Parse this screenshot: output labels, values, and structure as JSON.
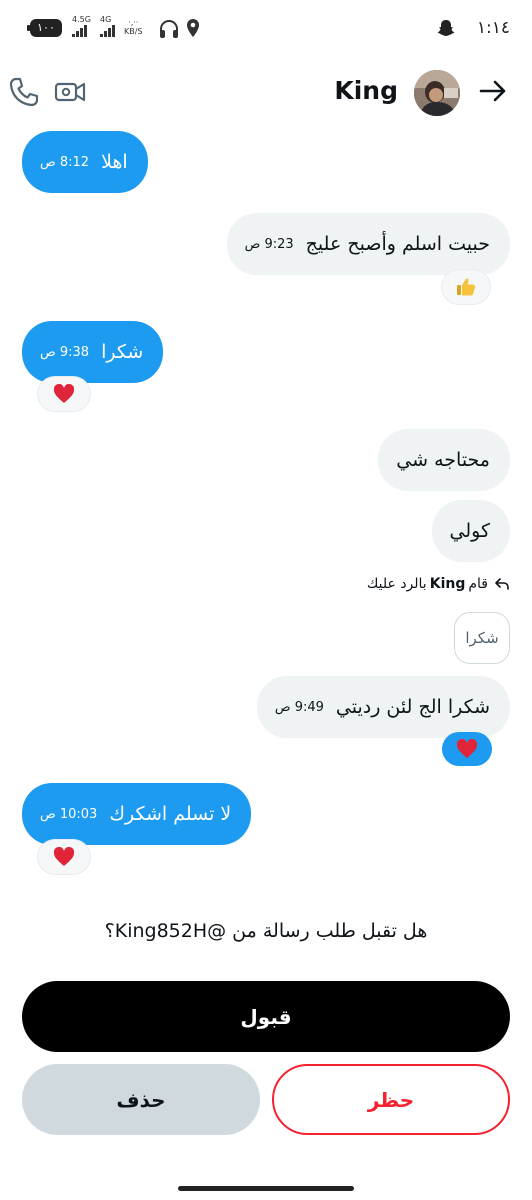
{
  "status_bar": {
    "time": "١:١٤",
    "battery": "١٠٠",
    "signal_1": "4.5G",
    "signal_2": "4G",
    "net_speed_value": "·,··",
    "net_speed_unit": "KB/S"
  },
  "header": {
    "contact_name": "King"
  },
  "messages": [
    {
      "text": "اهلا",
      "time": "8:12 ص",
      "direction": "incoming"
    },
    {
      "text": "حبيت اسلم وأصبح عليج",
      "time": "9:23 ص",
      "direction": "outgoing",
      "reaction": "thumbs-up"
    },
    {
      "text": "شكرا",
      "time": "9:38 ص",
      "direction": "incoming",
      "reaction": "heart"
    },
    {
      "text": "محتاجه شي",
      "time": "",
      "direction": "outgoing"
    },
    {
      "text": "كولي",
      "time": "",
      "direction": "outgoing"
    },
    {
      "text": "شكرا الج لئن رديتي",
      "time": "9:49 ص",
      "direction": "outgoing",
      "reaction": "heart"
    },
    {
      "text": "لا تسلم اشكرك",
      "time": "10:03 ص",
      "direction": "incoming",
      "reaction": "heart"
    }
  ],
  "reply_note": {
    "prefix": "قام",
    "name": "King",
    "suffix": "بالرد عليك",
    "quoted_text": "شكرا"
  },
  "request": {
    "question": "هل تقبل طلب رسالة من @King852H؟",
    "accept_label": "قبول",
    "delete_label": "حذف",
    "block_label": "حظر"
  },
  "colors": {
    "accent_blue": "#1d9bf0",
    "outgoing_bubble": "#eff3f4",
    "block_red": "#f4212e",
    "delete_gray": "#cfd9de"
  }
}
